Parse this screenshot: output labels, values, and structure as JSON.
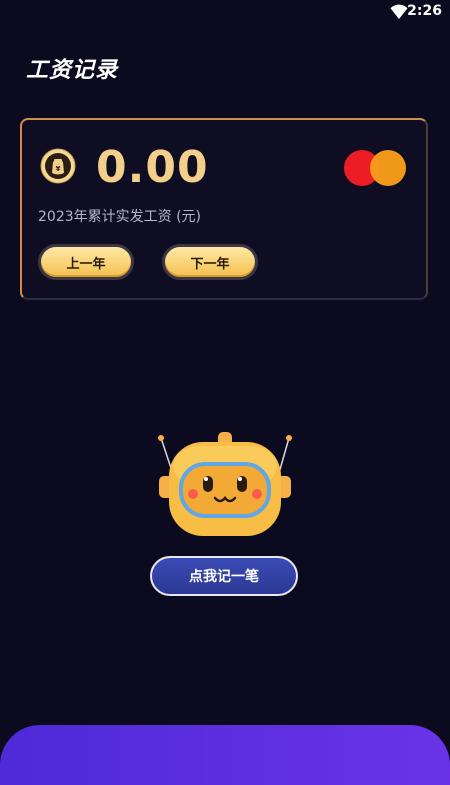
{
  "status_bar": {
    "time": "2:26",
    "wifi_icon": "wifi-icon"
  },
  "header": {
    "title": "工资记录"
  },
  "summary_card": {
    "amount": "0.00",
    "subtitle": "2023年累计实发工资 (元)",
    "prev_year_label": "上一年",
    "next_year_label": "下一年",
    "coin_icon": "money-bag-icon",
    "card_logo_colors": [
      "#ee1c25",
      "#f79e1b"
    ]
  },
  "mascot": {
    "icon": "robot-mascot"
  },
  "actions": {
    "record_label": "点我记一笔"
  },
  "colors": {
    "background": "#0b0a1f",
    "amount": "#f2d08c",
    "button_gold": "#f5c04e",
    "record_button": "#2b3893",
    "bottom_bar": "#5a2fe0"
  }
}
